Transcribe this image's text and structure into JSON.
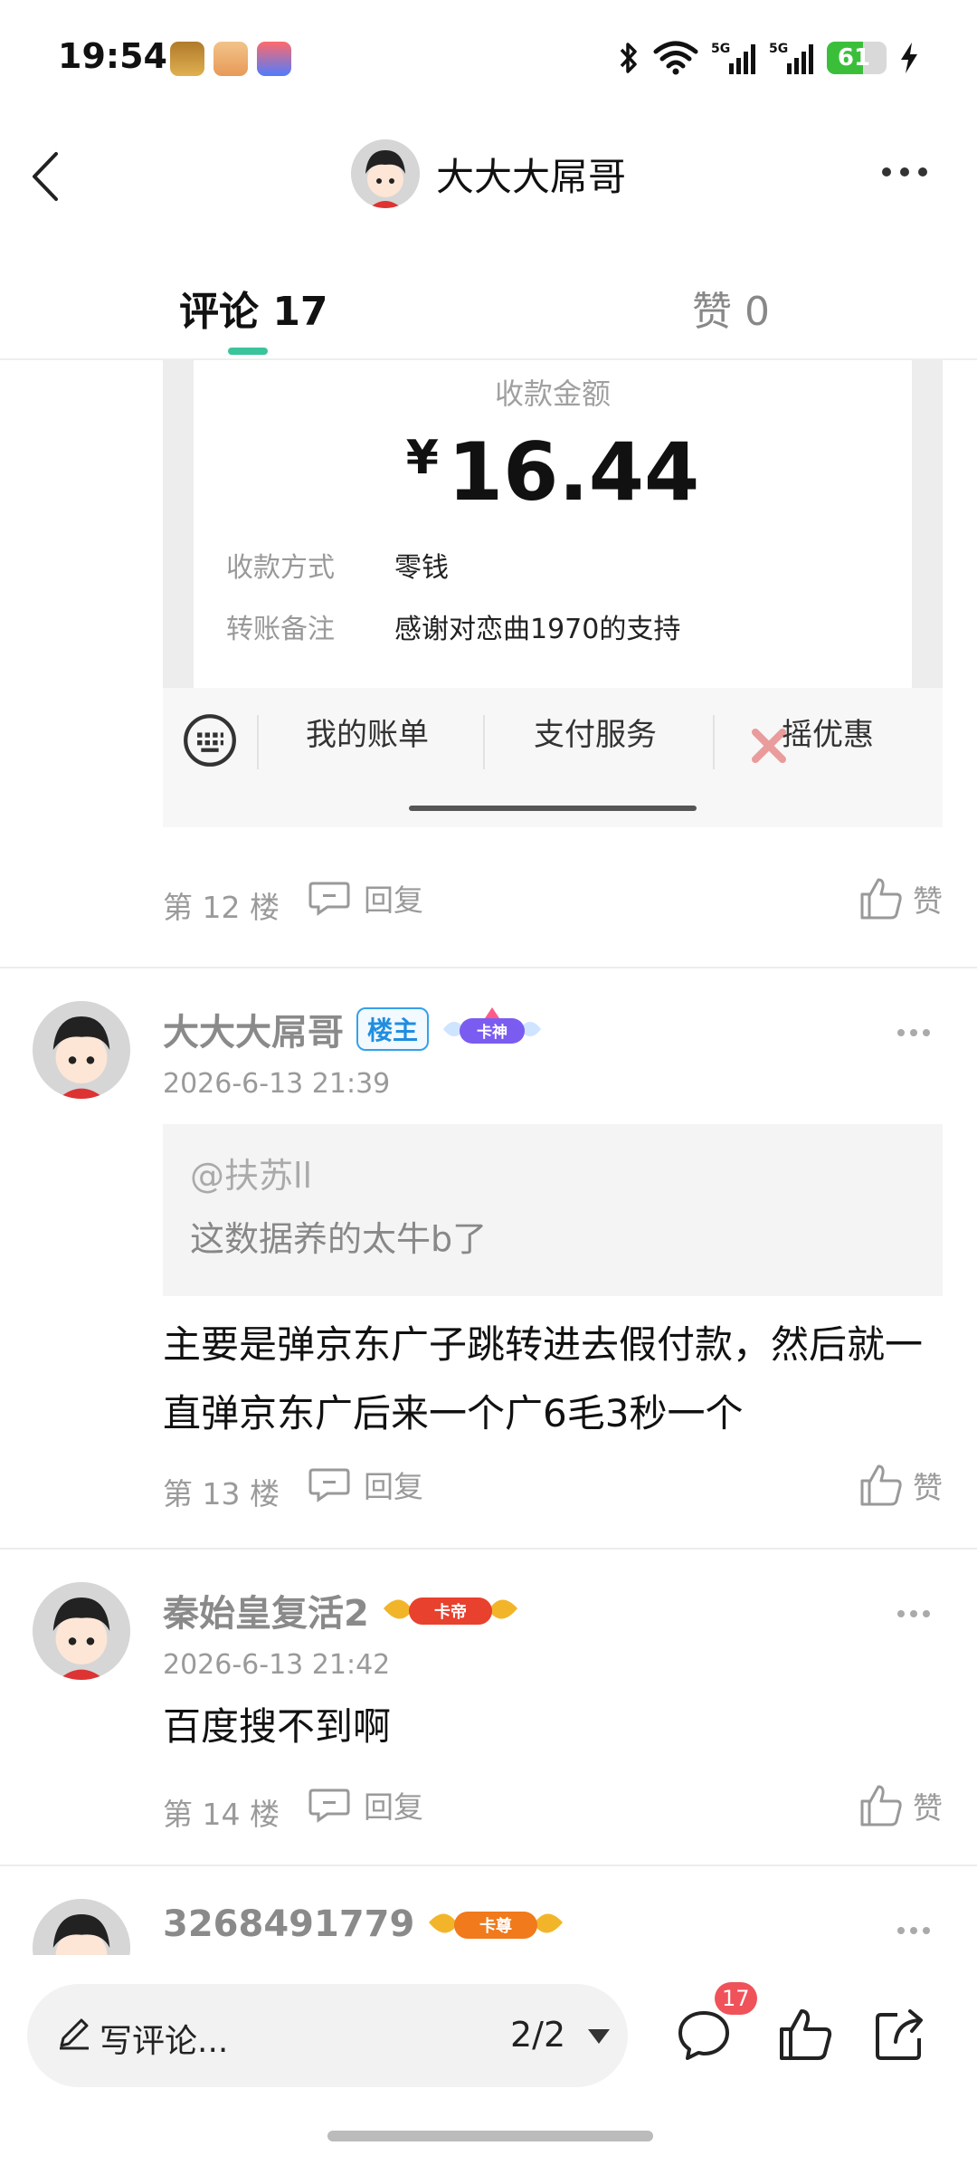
{
  "status_bar": {
    "time": "19:54",
    "battery_level": "61",
    "battery_fraction": 0.61,
    "icons": [
      "bluetooth-icon",
      "wifi-icon",
      "5g-signal-icon",
      "5g-signal-icon",
      "charging-icon"
    ]
  },
  "header": {
    "title": "大大大屌哥"
  },
  "tabs": {
    "comments": "评论 17",
    "likes": "赞 0"
  },
  "receipt": {
    "label": "收款金额",
    "currency": "¥",
    "amount": "16.44",
    "method_key": "收款方式",
    "method_value": "零钱",
    "note_key": "转账备注",
    "note_value": "感谢对恋曲1970的支持",
    "bar_items": [
      "我的账单",
      "支付服务",
      "摇优惠"
    ]
  },
  "floor_12": {
    "floor": "第 12 楼",
    "reply": "回复",
    "like": "赞"
  },
  "comments": [
    {
      "name": "大大大屌哥",
      "owner_badge": "楼主",
      "rank_badge": "卡神",
      "time": "2026-6-13 21:39",
      "quote_user": "@扶苏ll",
      "quote_text": "这数据养的太牛b了",
      "body": "主要是弹京东广子跳转进去假付款，然后就一直弹京东广后来一个广6毛3秒一个",
      "floor": "第 13 楼",
      "reply": "回复",
      "like": "赞"
    },
    {
      "name": "秦始皇复活2",
      "rank_badge": "卡帝",
      "time": "2026-6-13 21:42",
      "body": "百度搜不到啊",
      "floor": "第 14 楼",
      "reply": "回复",
      "like": "赞"
    },
    {
      "name": "3268491779",
      "rank_badge": "卡尊"
    }
  ],
  "bottom_bar": {
    "write_label": "写评论...",
    "page_indicator": "2/2",
    "comment_count": "17"
  },
  "colors": {
    "accent_green": "#3bc49b",
    "owner_badge_blue": "#1f8ee0",
    "notification_red": "#f0525a",
    "battery_green": "#3bbf3b"
  }
}
